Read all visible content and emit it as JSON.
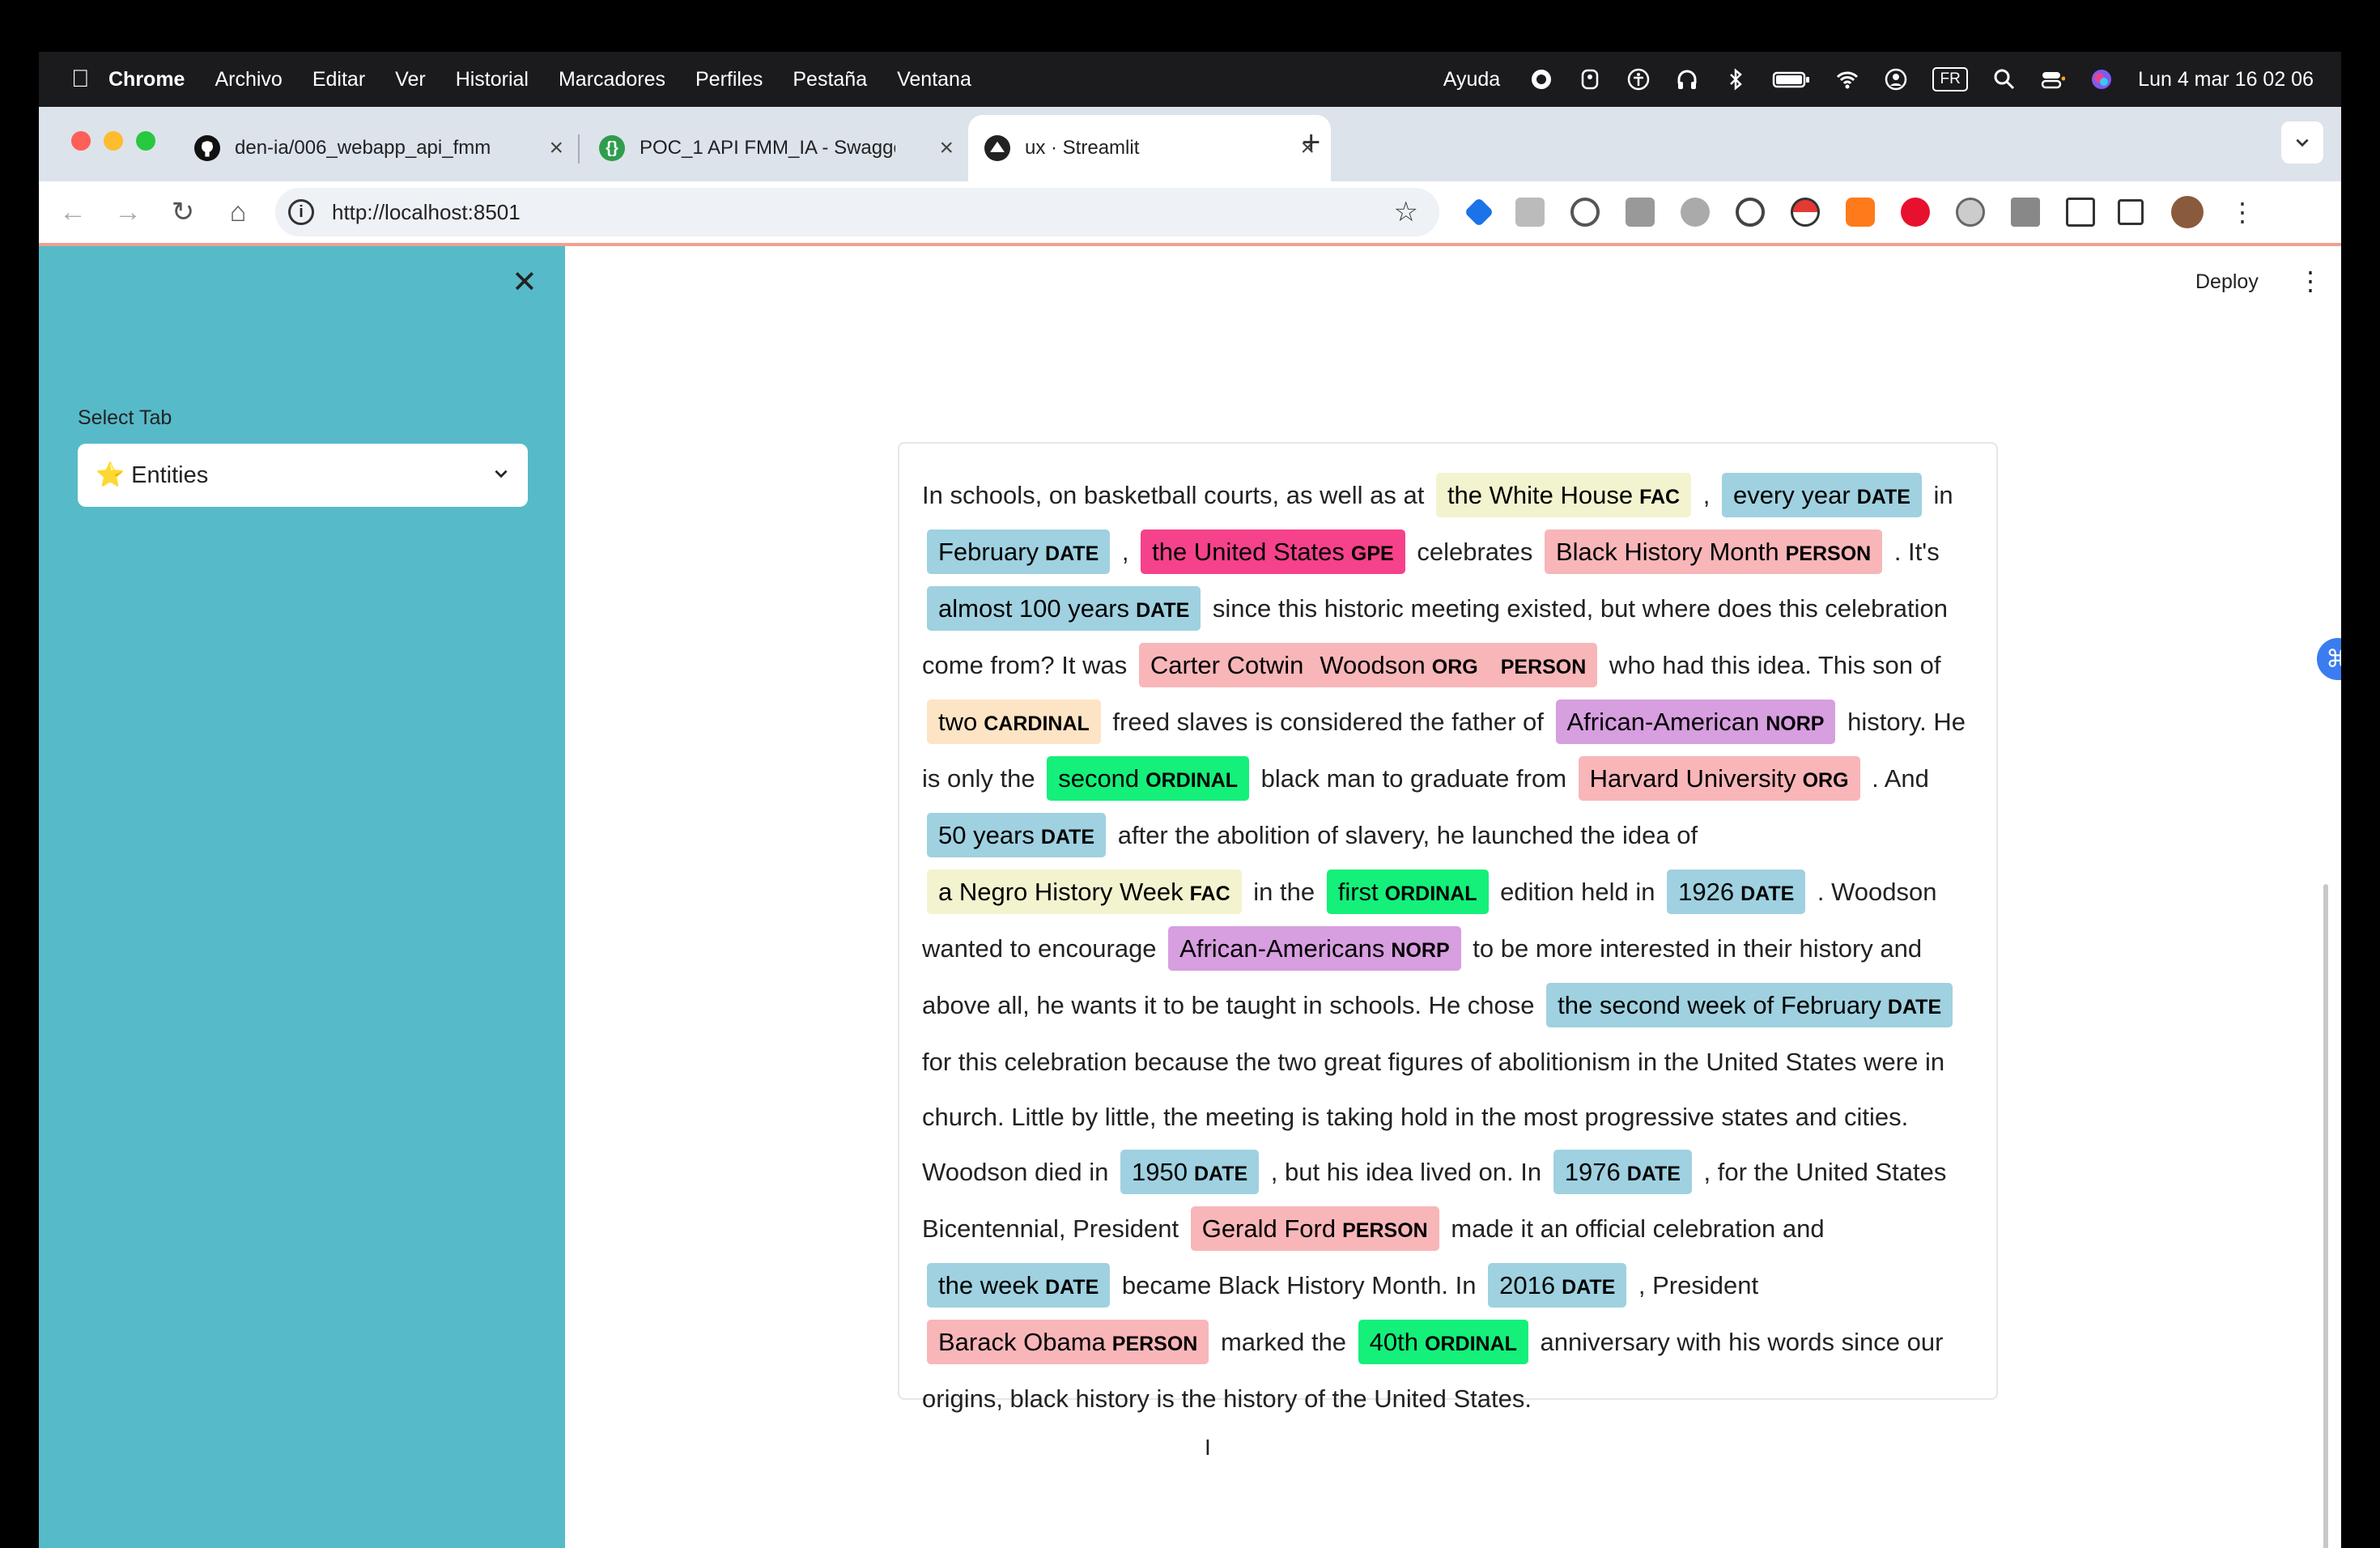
{
  "menubar": {
    "app": "Chrome",
    "items": [
      "Archivo",
      "Editar",
      "Ver",
      "Historial",
      "Marcadores",
      "Perfiles",
      "Pestaña",
      "Ventana"
    ],
    "help": "Ayuda",
    "input_source": "FR",
    "clock": "Lun 4 mar 16 02 06"
  },
  "tabs": [
    {
      "label": "den-ia/006_webapp_api_fmm",
      "icon": "github-icon"
    },
    {
      "label": "POC_1 API FMM_IA - Swagger",
      "icon": "swagger-icon"
    },
    {
      "label": "ux · Streamlit",
      "icon": "streamlit-icon"
    }
  ],
  "toolbar": {
    "url": "http://localhost:8501"
  },
  "sidebar": {
    "select_label": "Select Tab",
    "selected_emoji": "⭐",
    "selected_value": "Entities"
  },
  "header": {
    "deploy_label": "Deploy"
  },
  "ner": {
    "colors": {
      "FAC": "#f4f3cf",
      "DATE": "#9fd1e0",
      "GPE": "#f5428b",
      "PERSON": "#f8b6b9",
      "ORG": "#f8b6b9",
      "CARDINAL": "#fde4c4",
      "NORP": "#d79ee0",
      "ORDINAL": "#14f07a"
    },
    "segments": [
      {
        "t": "In schools, on basketball courts, as well as at "
      },
      {
        "e": "the White House",
        "l": "FAC"
      },
      {
        "t": " , "
      },
      {
        "e": "every year",
        "l": "DATE"
      },
      {
        "t": " in "
      },
      {
        "e": "February",
        "l": "DATE"
      },
      {
        "t": " , "
      },
      {
        "e": "the United States",
        "l": "GPE"
      },
      {
        "t": " celebrates "
      },
      {
        "e": "Black History Month",
        "l": "PERSON"
      },
      {
        "t": " . It's "
      },
      {
        "e": "almost 100 years",
        "l": "DATE"
      },
      {
        "t": " since this historic meeting existed, but where does this celebration come from? It was "
      },
      {
        "e": "Carter Cotwin",
        "l": "PERSON",
        "nested": {
          "e": "Woodson",
          "l": "ORG"
        }
      },
      {
        "t": " who had this idea. This son of "
      },
      {
        "e": "two",
        "l": "CARDINAL"
      },
      {
        "t": " freed slaves is considered the father of "
      },
      {
        "e": "African-American",
        "l": "NORP"
      },
      {
        "t": " history. He is only the "
      },
      {
        "e": "second",
        "l": "ORDINAL"
      },
      {
        "t": " black man to graduate from "
      },
      {
        "e": "Harvard University",
        "l": "ORG"
      },
      {
        "t": " . And "
      },
      {
        "e": "50 years",
        "l": "DATE"
      },
      {
        "t": " after the abolition of slavery, he launched the idea of "
      },
      {
        "e": "a Negro History Week",
        "l": "FAC"
      },
      {
        "t": " in the "
      },
      {
        "e": "first",
        "l": "ORDINAL"
      },
      {
        "t": " edition held in "
      },
      {
        "e": "1926",
        "l": "DATE"
      },
      {
        "t": " . Woodson wanted to encourage "
      },
      {
        "e": "African-Americans",
        "l": "NORP"
      },
      {
        "t": " to be more interested in their history and above all, he wants it to be taught in schools. He chose "
      },
      {
        "e": "the second week of February",
        "l": "DATE"
      },
      {
        "t": " for this celebration because the two great figures of abolitionism in the United States were in church. Little by little, the meeting is taking hold in the most progressive states and cities. Woodson died in "
      },
      {
        "e": "1950",
        "l": "DATE"
      },
      {
        "t": " , but his idea lived on. In "
      },
      {
        "e": "1976",
        "l": "DATE"
      },
      {
        "t": " , for the United States Bicentennial, President "
      },
      {
        "e": "Gerald Ford",
        "l": "PERSON"
      },
      {
        "t": " made it an official celebration and "
      },
      {
        "e": "the week",
        "l": "DATE"
      },
      {
        "t": " became Black History Month. In "
      },
      {
        "e": "2016",
        "l": "DATE"
      },
      {
        "t": " , President "
      },
      {
        "e": "Barack Obama",
        "l": "PERSON"
      },
      {
        "t": " marked the "
      },
      {
        "e": "40th",
        "l": "ORDINAL"
      },
      {
        "t": " anniversary with his words since our origins, black history is the history of the United States."
      }
    ]
  }
}
